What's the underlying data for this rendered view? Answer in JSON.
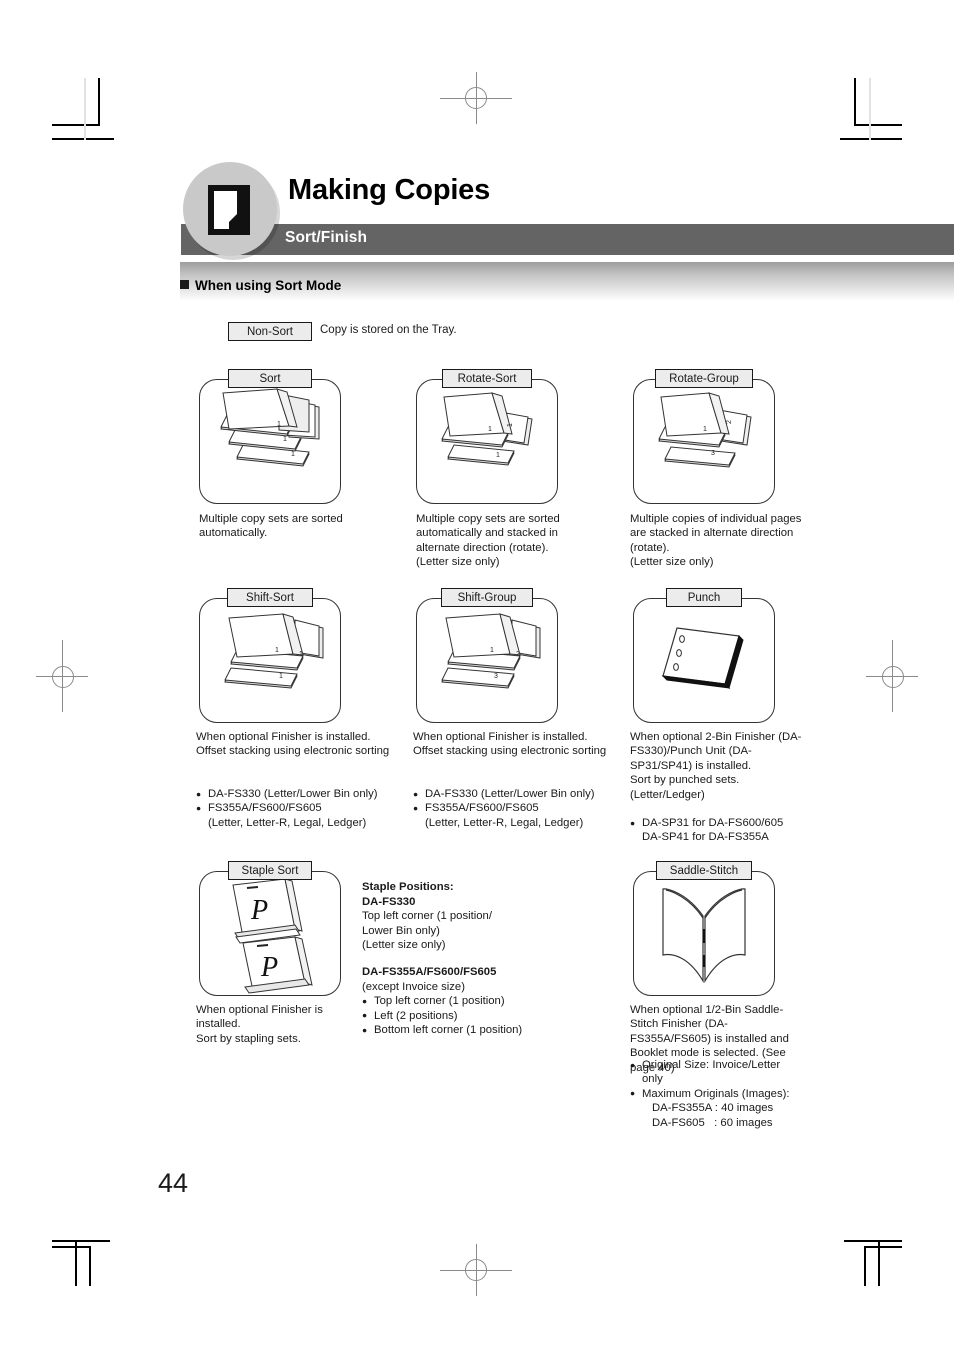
{
  "header": {
    "chapter_icon": "document-page-icon",
    "title": "Making Copies",
    "subtitle": "Sort/Finish",
    "bar_color": "#646464",
    "badge_color": "#c9c9c9"
  },
  "section": {
    "heading": "When using Sort Mode"
  },
  "non_sort": {
    "label": "Non-Sort",
    "description": "Copy is stored on the Tray."
  },
  "panels": [
    {
      "id": "sort",
      "label": "Sort",
      "art": "three-offset-stacks-labeled-1",
      "caption": "Multiple copy sets are sorted automatically.",
      "bullets": []
    },
    {
      "id": "rotate-sort",
      "label": "Rotate-Sort",
      "art": "rotated-stacks-labeled-1",
      "caption": "Multiple copy sets are sorted automatically and stacked in alternate direction (rotate).\n(Letter size only)",
      "bullets": []
    },
    {
      "id": "rotate-group",
      "label": "Rotate-Group",
      "art": "rotated-stacks-labeled-1-2-3",
      "caption": "Multiple copies of individual pages are stacked in alternate direction (rotate).\n(Letter size only)",
      "bullets": []
    },
    {
      "id": "shift-sort",
      "label": "Shift-Sort",
      "art": "shifted-stacks-labeled-1",
      "caption": "When optional Finisher is installed. Offset stacking using electronic sorting",
      "bullets": [
        "DA-FS330 (Letter/Lower Bin only)",
        "FS355A/FS600/FS605"
      ],
      "sub_bullets": [
        "(Letter, Letter-R, Legal, Ledger)"
      ]
    },
    {
      "id": "shift-group",
      "label": "Shift-Group",
      "art": "shifted-stacks-labeled-1-2-3",
      "caption": "When optional Finisher is installed. Offset stacking using electronic sorting",
      "bullets": [
        "DA-FS330 (Letter/Lower Bin only)",
        "FS355A/FS600/FS605"
      ],
      "sub_bullets": [
        "(Letter, Letter-R, Legal, Ledger)"
      ]
    },
    {
      "id": "punch",
      "label": "Punch",
      "art": "punched-sheet-three-holes",
      "caption": "When optional 2-Bin Finisher (DA-FS330)/Punch Unit (DA-SP31/SP41) is installed.\nSort by punched sets.\n(Letter/Ledger)",
      "bullets": [
        "DA-SP31 for DA-FS600/605"
      ],
      "sub_bullets": [
        "DA-SP41 for DA-FS355A"
      ]
    },
    {
      "id": "staple-sort",
      "label": "Staple Sort",
      "art": "two-stapled-stacks-letter-p",
      "caption": "When optional Finisher is installed.\nSort by stapling sets.",
      "bullets": []
    },
    {
      "id": "saddle-stitch",
      "label": "Saddle-Stitch",
      "art": "open-booklet-with-stitches",
      "caption": "When optional 1/2-Bin Saddle-Stitch Finisher (DA-FS355A/FS605) is installed and Booklet mode is selected. (See page 40)",
      "bullets": [
        "Original Size: Invoice/Letter",
        "Maximum Originals (Images):"
      ],
      "sub_bullets": [
        "only",
        "DA-FS355A : 40 images",
        "DA-FS605   : 60 images"
      ]
    }
  ],
  "staple_positions": {
    "title": "Staple Positions:",
    "group1_model": "DA-FS330",
    "group1_lines": [
      "Top left corner (1 position/",
      "Lower Bin only)",
      "(Letter size only)"
    ],
    "group2_model": "DA-FS355A/FS600/FS605",
    "group2_note": "(except Invoice size)",
    "group2_bullets": [
      "Top left corner (1 position)",
      "Left (2 positions)",
      "Bottom left corner (1 position)"
    ]
  },
  "footer": {
    "page_number": "44"
  }
}
